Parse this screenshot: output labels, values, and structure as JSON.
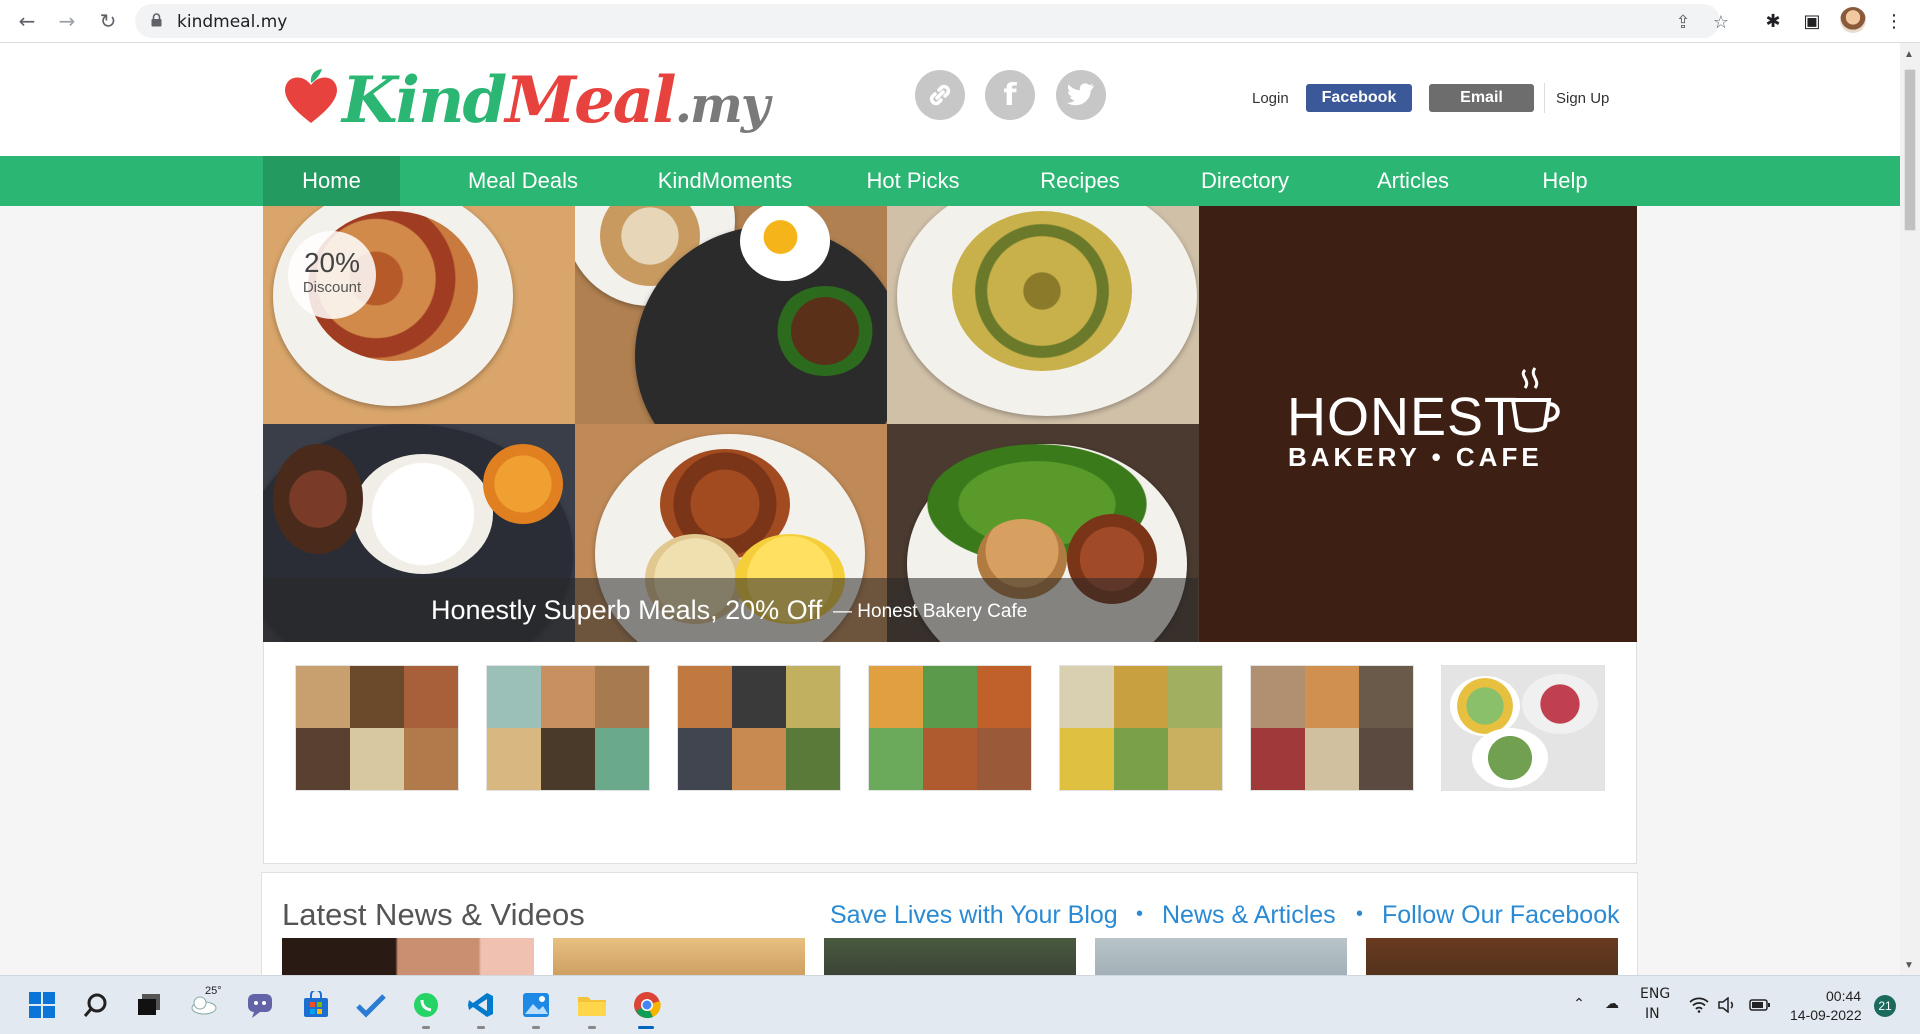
{
  "browser": {
    "url": "kindmeal.my",
    "back_icon": "arrow-left-icon",
    "forward_icon": "arrow-right-icon",
    "reload_icon": "reload-icon"
  },
  "header": {
    "logo": {
      "kind": "Kind",
      "meal": "Meal",
      "suffix": ".my"
    },
    "social_icons": [
      "link-icon",
      "facebook-icon",
      "twitter-icon"
    ],
    "login_label": "Login",
    "facebook_label": "Facebook",
    "email_label": "Email",
    "signup_label": "Sign Up",
    "colors": {
      "brand_green": "#2bb673",
      "brand_red": "#e8423f",
      "facebook_blue": "#3b5998"
    }
  },
  "nav": {
    "items": [
      {
        "label": "Home"
      },
      {
        "label": "Meal Deals"
      },
      {
        "label": "KindMoments"
      },
      {
        "label": "Hot Picks"
      },
      {
        "label": "Recipes"
      },
      {
        "label": "Directory"
      },
      {
        "label": "Articles"
      },
      {
        "label": "Help"
      }
    ],
    "active": "Home"
  },
  "hero": {
    "discount_value": "20%",
    "discount_label": "Discount",
    "caption_main": "Honestly Superb Meals, 20% Off",
    "caption_sub": "— Honest Bakery Cafe",
    "brand_name": "HONEST",
    "brand_tagline": "BAKERY • CAFE"
  },
  "thumbnails": {
    "count": 7
  },
  "news": {
    "title": "Latest News & Videos",
    "links": [
      "Save Lives with Your Blog",
      "News & Articles",
      "Follow Our Facebook"
    ],
    "separator": "•"
  },
  "taskbar": {
    "weather_temp": "25°",
    "lang_top": "ENG",
    "lang_bottom": "IN",
    "time": "00:44",
    "date": "14-09-2022",
    "notification_count": "21"
  }
}
